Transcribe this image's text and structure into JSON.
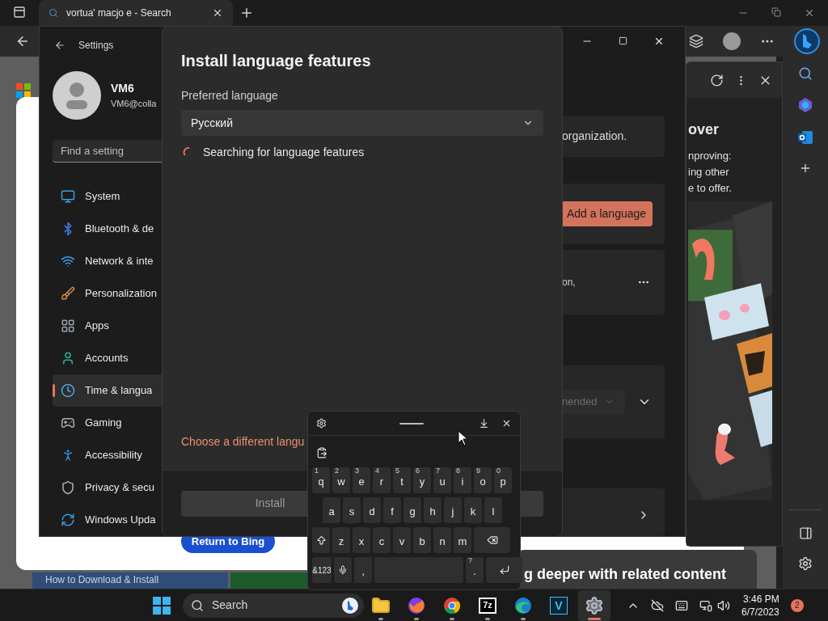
{
  "browser": {
    "tab_title": "vortua' macjo e - Search",
    "page": {
      "return_button": "Return to Bing",
      "article_title": "How to Download & Install",
      "section_heading": "g deeper with related content"
    },
    "side_panel": {
      "heading": "over",
      "lines": [
        "nproving:",
        "ing other",
        "e to offer."
      ]
    }
  },
  "settings": {
    "title": "Settings",
    "user": {
      "name": "VM6",
      "email": "VM6@colla"
    },
    "search_placeholder": "Find a setting",
    "nav": [
      {
        "label": "System",
        "selected": false
      },
      {
        "label": "Bluetooth & de",
        "selected": false
      },
      {
        "label": "Network & inte",
        "selected": false
      },
      {
        "label": "Personalization",
        "selected": false
      },
      {
        "label": "Apps",
        "selected": false
      },
      {
        "label": "Accounts",
        "selected": false
      },
      {
        "label": "Time & langua",
        "selected": true
      },
      {
        "label": "Gaming",
        "selected": false
      },
      {
        "label": "Accessibility",
        "selected": false
      },
      {
        "label": "Privacy & secu",
        "selected": false
      },
      {
        "label": "Windows Upda",
        "selected": false
      }
    ],
    "content": {
      "org_text": "organization.",
      "add_button": "Add a language",
      "row_text": "on,",
      "dropdown_text": "nended"
    }
  },
  "dialog": {
    "title": "Install language features",
    "field_label": "Preferred language",
    "language": "Русский",
    "status": "Searching for language features",
    "link": "Choose a different langu",
    "primary_button": {
      "label": "Install",
      "disabled": true
    }
  },
  "keyboard": {
    "rows": [
      [
        {
          "kind": "letter",
          "label": "q",
          "hint": "1"
        },
        {
          "kind": "letter",
          "label": "w",
          "hint": "2"
        },
        {
          "kind": "letter",
          "label": "e",
          "hint": "3"
        },
        {
          "kind": "letter",
          "label": "r",
          "hint": "4"
        },
        {
          "kind": "letter",
          "label": "t",
          "hint": "5"
        },
        {
          "kind": "letter",
          "label": "y",
          "hint": "6"
        },
        {
          "kind": "letter",
          "label": "u",
          "hint": "7"
        },
        {
          "kind": "letter",
          "label": "i",
          "hint": "8"
        },
        {
          "kind": "letter",
          "label": "o",
          "hint": "9"
        },
        {
          "kind": "letter",
          "label": "p",
          "hint": "0"
        }
      ],
      [
        {
          "kind": "letter",
          "label": "a"
        },
        {
          "kind": "letter",
          "label": "s"
        },
        {
          "kind": "letter",
          "label": "d"
        },
        {
          "kind": "letter",
          "label": "f"
        },
        {
          "kind": "letter",
          "label": "g"
        },
        {
          "kind": "letter",
          "label": "h"
        },
        {
          "kind": "letter",
          "label": "j"
        },
        {
          "kind": "letter",
          "label": "k"
        },
        {
          "kind": "letter",
          "label": "l"
        }
      ],
      [
        {
          "kind": "shift"
        },
        {
          "kind": "letter",
          "label": "z"
        },
        {
          "kind": "letter",
          "label": "x"
        },
        {
          "kind": "letter",
          "label": "c"
        },
        {
          "kind": "letter",
          "label": "v"
        },
        {
          "kind": "letter",
          "label": "b"
        },
        {
          "kind": "letter",
          "label": "n"
        },
        {
          "kind": "letter",
          "label": "m"
        },
        {
          "kind": "backspace"
        }
      ],
      [
        {
          "kind": "mode",
          "label": "&123"
        },
        {
          "kind": "mic"
        },
        {
          "kind": "letter",
          "label": ","
        },
        {
          "kind": "space"
        },
        {
          "kind": "letter",
          "label": ".",
          "hint": "?"
        },
        {
          "kind": "enter"
        }
      ]
    ]
  },
  "taskbar": {
    "search_label": "Search",
    "apps": [
      {
        "kind": "folder",
        "running": true,
        "selected": false
      },
      {
        "kind": "fox",
        "running": true,
        "selected": false
      },
      {
        "kind": "ball",
        "running": true,
        "selected": false
      },
      {
        "kind": "tile",
        "label": "7z",
        "running": true,
        "selected": false
      },
      {
        "kind": "wave",
        "running": true,
        "selected": false
      },
      {
        "kind": "tile-blue",
        "label": "V",
        "running": false,
        "selected": false
      },
      {
        "kind": "gear",
        "running": true,
        "selected": true
      }
    ],
    "time": "3:46 PM",
    "date": "6/7/2023",
    "notifications": "2"
  }
}
